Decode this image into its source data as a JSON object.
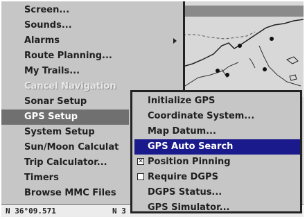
{
  "main_menu": {
    "items": [
      {
        "label": "Screen..."
      },
      {
        "label": "Sounds..."
      },
      {
        "label": "Alarms"
      },
      {
        "label": "Route Planning..."
      },
      {
        "label": "My Trails..."
      },
      {
        "label": "Cancel Navigation"
      },
      {
        "label": "Sonar Setup"
      },
      {
        "label": "GPS Setup"
      },
      {
        "label": "System Setup"
      },
      {
        "label": "Sun/Moon Calculat"
      },
      {
        "label": "Trip Calculator..."
      },
      {
        "label": "Timers"
      },
      {
        "label": "Browse MMC Files"
      }
    ],
    "selected": "GPS Setup",
    "disabled": "Cancel Navigation"
  },
  "gps_submenu": {
    "items": [
      {
        "label": "Initialize GPS"
      },
      {
        "label": "Coordinate System..."
      },
      {
        "label": "Map Datum..."
      },
      {
        "label": "GPS Auto Search"
      },
      {
        "label": "Position Pinning",
        "checked": true
      },
      {
        "label": "Require DGPS",
        "checked": false
      },
      {
        "label": "DGPS Status..."
      },
      {
        "label": "GPS Simulator..."
      }
    ],
    "highlighted": "GPS Auto Search"
  },
  "status_bar": {
    "left_reading": "N 36°09.571",
    "right_fragment": "N 3"
  },
  "colors": {
    "menu_background": "#c6c6c6",
    "selected_item": "#707070",
    "highlight_item": "#1a1a8c",
    "text": "#202020"
  },
  "icons": {
    "submenu_arrow": "chevron-right-icon",
    "checkbox_checked": "checkbox-checked-icon",
    "checkbox_empty": "checkbox-empty-icon"
  }
}
